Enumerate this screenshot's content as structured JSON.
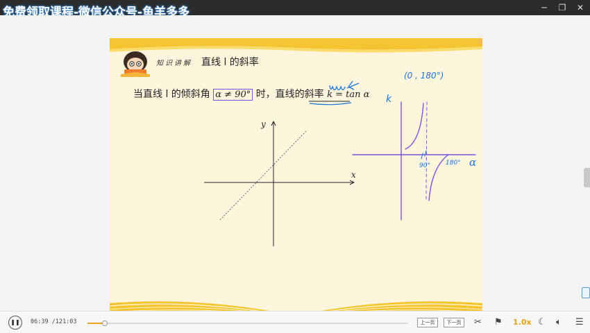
{
  "watermark": "免费领取课程-微信公众号-鱼羊多多",
  "window_controls": {
    "minimize": "─",
    "restore": "❐",
    "close": "✕"
  },
  "slide": {
    "section_label": "知识讲解",
    "title": "直线 l 的斜率",
    "sentence_part1": "当直线 l 的倾斜角",
    "condition": "α ≠ 90°",
    "sentence_part2": "时，直线的斜率",
    "formula": "k = tan α",
    "axis_x": "x",
    "axis_y": "y"
  },
  "handwriting": {
    "interval": "(0 , 180°)",
    "k_label": "k",
    "alpha_label": "α",
    "tick_90": "90°",
    "tick_180": "180°"
  },
  "player": {
    "time_current": "06:39",
    "time_total": "/121:03",
    "progress_fraction": 0.055,
    "prev_page": "上一页",
    "next_page": "下一页",
    "speed": "1.0x"
  },
  "colors": {
    "accent_speed": "#e8a21a",
    "ink_blue": "#1a73d9",
    "ink_purple": "#7b4fe0"
  }
}
